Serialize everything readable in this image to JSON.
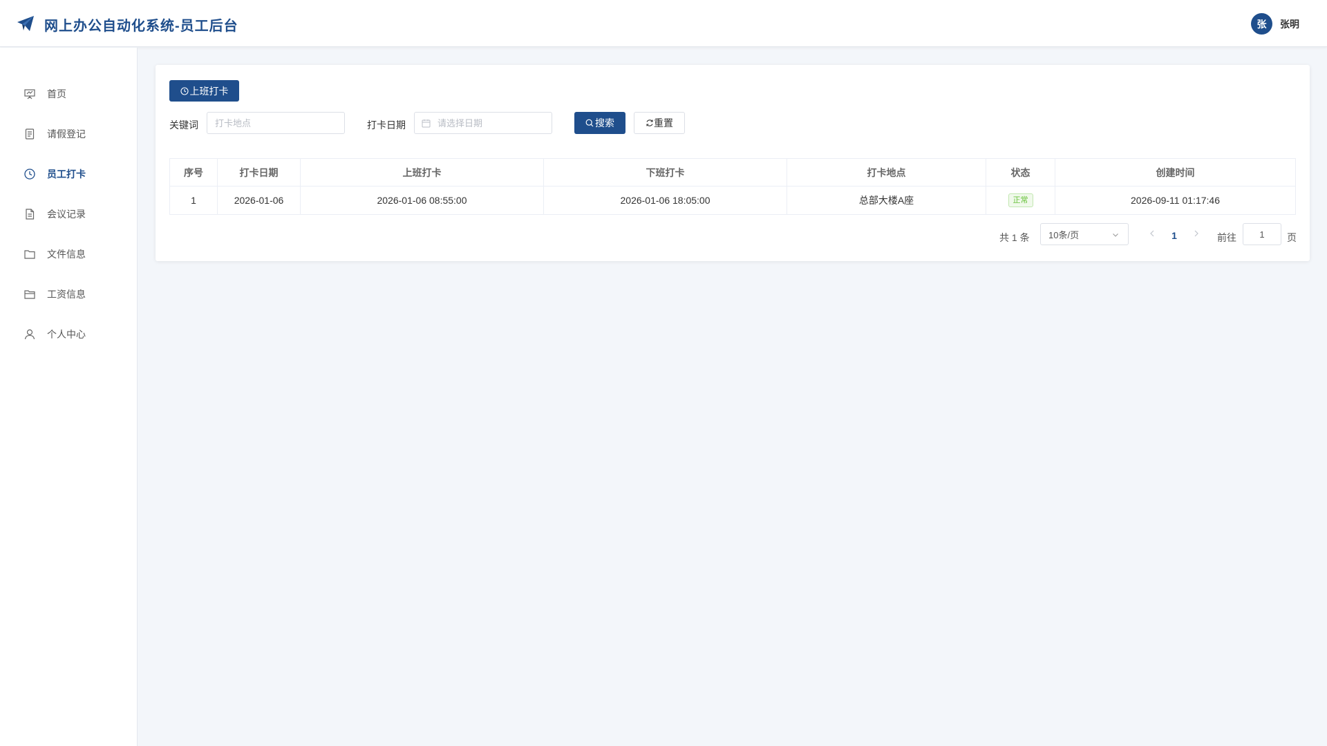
{
  "header": {
    "title": "网上办公自动化系统-员工后台",
    "avatar_text": "张",
    "user_name": "张明",
    "accent_color": "#1f4e8c"
  },
  "sidebar": {
    "items": [
      {
        "label": "首页",
        "icon": "presentation-icon",
        "active": false
      },
      {
        "label": "请假登记",
        "icon": "document-icon",
        "active": false
      },
      {
        "label": "员工打卡",
        "icon": "clock-icon",
        "active": true
      },
      {
        "label": "会议记录",
        "icon": "file-text-icon",
        "active": false
      },
      {
        "label": "文件信息",
        "icon": "folder-icon",
        "active": false
      },
      {
        "label": "工资信息",
        "icon": "folder-open-icon",
        "active": false
      },
      {
        "label": "个人中心",
        "icon": "user-icon",
        "active": false
      }
    ]
  },
  "toolbar": {
    "clock_in_label": "上班打卡"
  },
  "search": {
    "keyword_label": "关键词",
    "keyword_placeholder": "打卡地点",
    "keyword_value": "",
    "date_label": "打卡日期",
    "date_placeholder": "请选择日期",
    "search_label": "搜索",
    "reset_label": "重置"
  },
  "table": {
    "columns": [
      "序号",
      "打卡日期",
      "上班打卡",
      "下班打卡",
      "打卡地点",
      "状态",
      "创建时间"
    ],
    "rows": [
      {
        "index": "1",
        "date": "2026-01-06",
        "clock_in": "2026-01-06 08:55:00",
        "clock_out": "2026-01-06 18:05:00",
        "location": "总部大楼A座",
        "status": "正常",
        "created": "2026-09-11 01:17:46"
      }
    ]
  },
  "pagination": {
    "total": "共 1 条",
    "page_size": "10条/页",
    "current_page": "1",
    "goto_label": "前往",
    "goto_value": "1",
    "page_suffix": "页"
  }
}
